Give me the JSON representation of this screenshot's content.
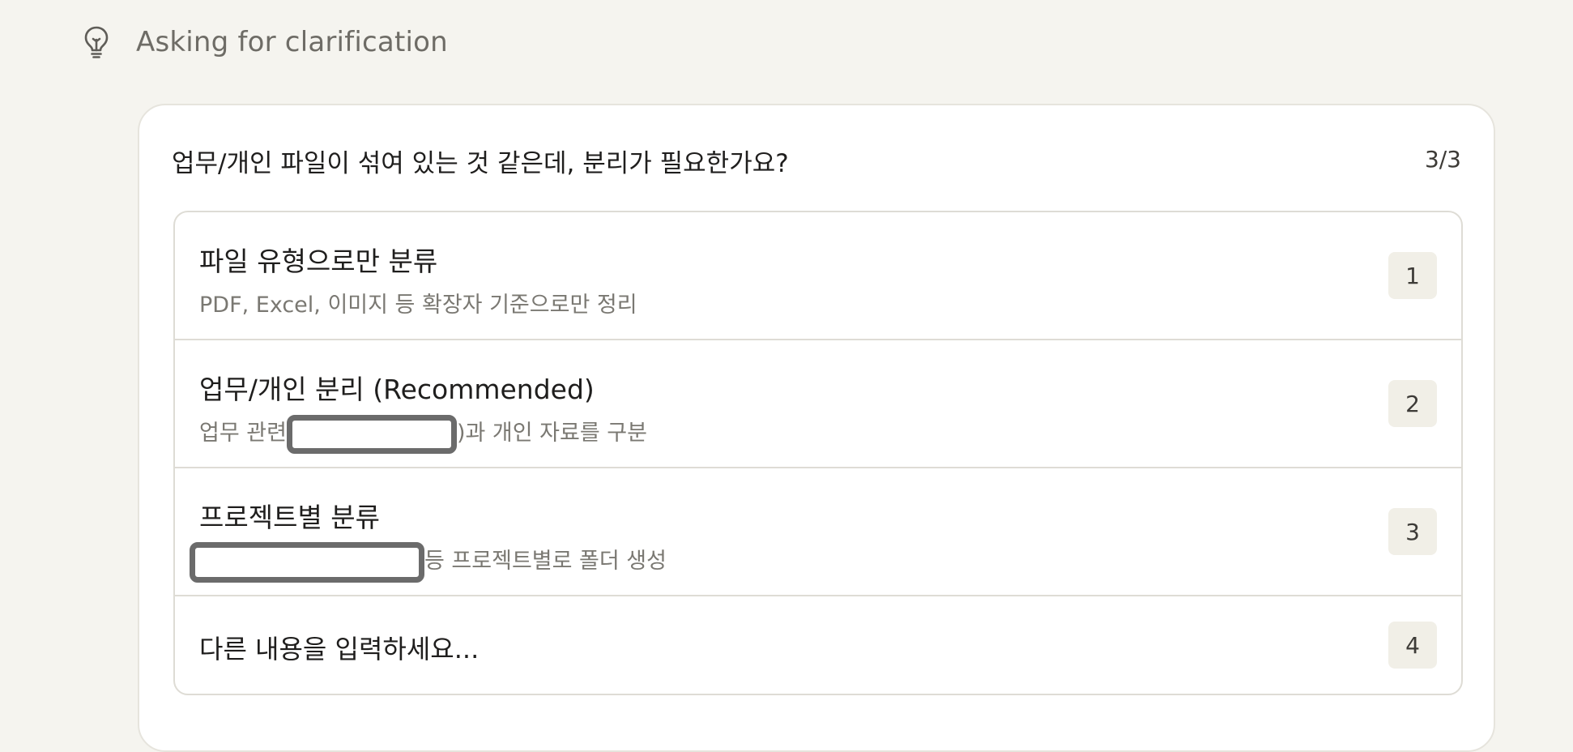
{
  "header": {
    "icon": "lightbulb-icon",
    "title": "Asking for clarification"
  },
  "question": {
    "text": "업무/개인 파일이 섞여 있는 것 같은데, 분리가 필요한가요?",
    "counter": "3/3"
  },
  "options": [
    {
      "title": "파일 유형으로만 분류",
      "description": "PDF, Excel, 이미지 등 확장자 기준으로만 정리",
      "key": "1"
    },
    {
      "title": "업무/개인 분리 (Recommended)",
      "description_before": "업무 관련",
      "description_after": ")과 개인 자료를 구분",
      "key": "2"
    },
    {
      "title": "프로젝트별 분류",
      "description_after": "등 프로젝트별로 폴더 생성",
      "key": "3"
    },
    {
      "placeholder": "다른 내용을 입력하세요...",
      "key": "4"
    }
  ]
}
